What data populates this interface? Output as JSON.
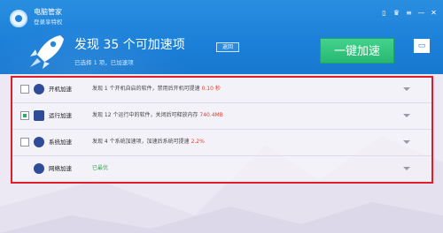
{
  "app": {
    "title": "电脑管家",
    "subtitle": "登录享特权"
  },
  "window_controls": [
    {
      "name": "phone-icon",
      "glyph": "▯"
    },
    {
      "name": "skin-icon",
      "glyph": "♛"
    },
    {
      "name": "menu-icon",
      "glyph": "≡"
    },
    {
      "name": "minimize-icon",
      "glyph": "—"
    },
    {
      "name": "close-icon",
      "glyph": "✕"
    }
  ],
  "summary": {
    "title": "发现 35 个可加速项",
    "back_label": "返回",
    "selected_note": "已选择 1 项，已加速项"
  },
  "actions": {
    "accelerate_label": "一键加速",
    "side_icon": "▭"
  },
  "items": [
    {
      "name": "开机加速",
      "desc_prefix": "发现 1 个开机自启的软件，禁用后开机可提速",
      "highlight": "0.10 秒",
      "checked": false,
      "icon_color": "#2e4c98"
    },
    {
      "name": "运行加速",
      "desc_prefix": "发现 12 个运行中的软件，关闭后可释放内存",
      "highlight": "740.4MB",
      "checked": true,
      "icon_color": "#2e4c98"
    },
    {
      "name": "系统加速",
      "desc_prefix": "发现 4 个系统加速项，加速后系统可提速",
      "highlight": "2.2%",
      "checked": false,
      "icon_color": "#2e4c98"
    },
    {
      "name": "网络加速",
      "status": "已最优",
      "icon_color": "#2e4c98"
    }
  ],
  "colors": {
    "header": "#1c7fd8",
    "accent_green": "#26b872",
    "frame_red": "#e21d2a",
    "highlight_red": "#e23d2d"
  }
}
